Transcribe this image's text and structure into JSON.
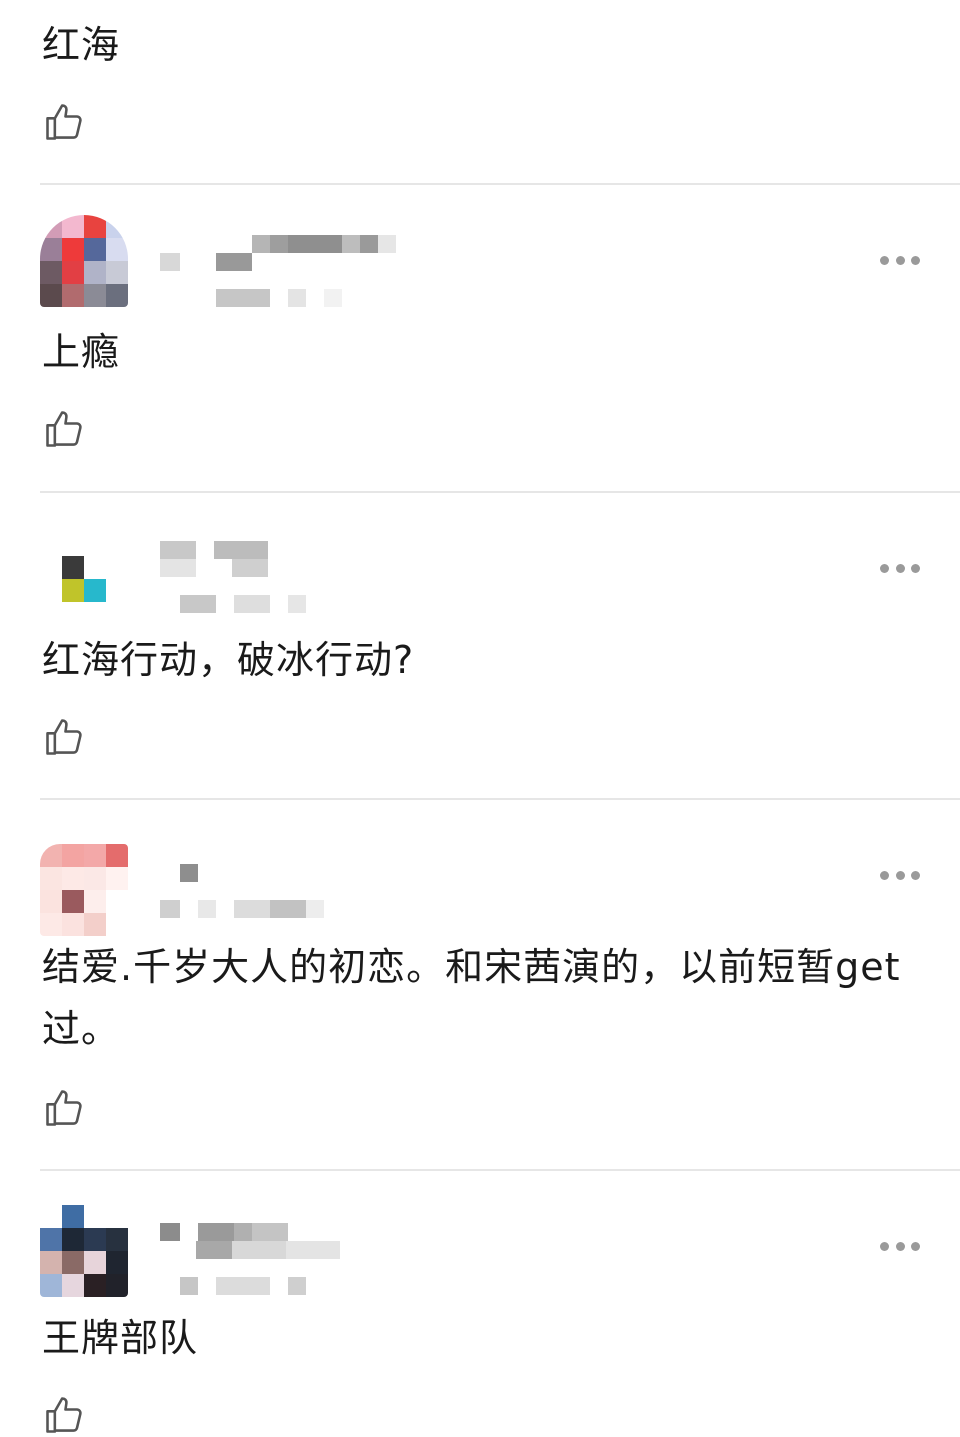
{
  "comments": [
    {
      "text": "红海",
      "has_header": false
    },
    {
      "text": "上瘾",
      "has_header": true
    },
    {
      "text": "红海行动，破冰行动?",
      "has_header": true
    },
    {
      "text": "结爱.千岁大人的初恋。和宋茜演的，以前短暂get过。",
      "has_header": true
    },
    {
      "text": "王牌部队",
      "has_header": true
    }
  ],
  "icons": {
    "like": "thumbs-up-icon",
    "more": "more-horizontal-icon"
  },
  "colors": {
    "divider": "#e6e6e6",
    "text": "#1a1a1a",
    "icon": "#555555"
  }
}
